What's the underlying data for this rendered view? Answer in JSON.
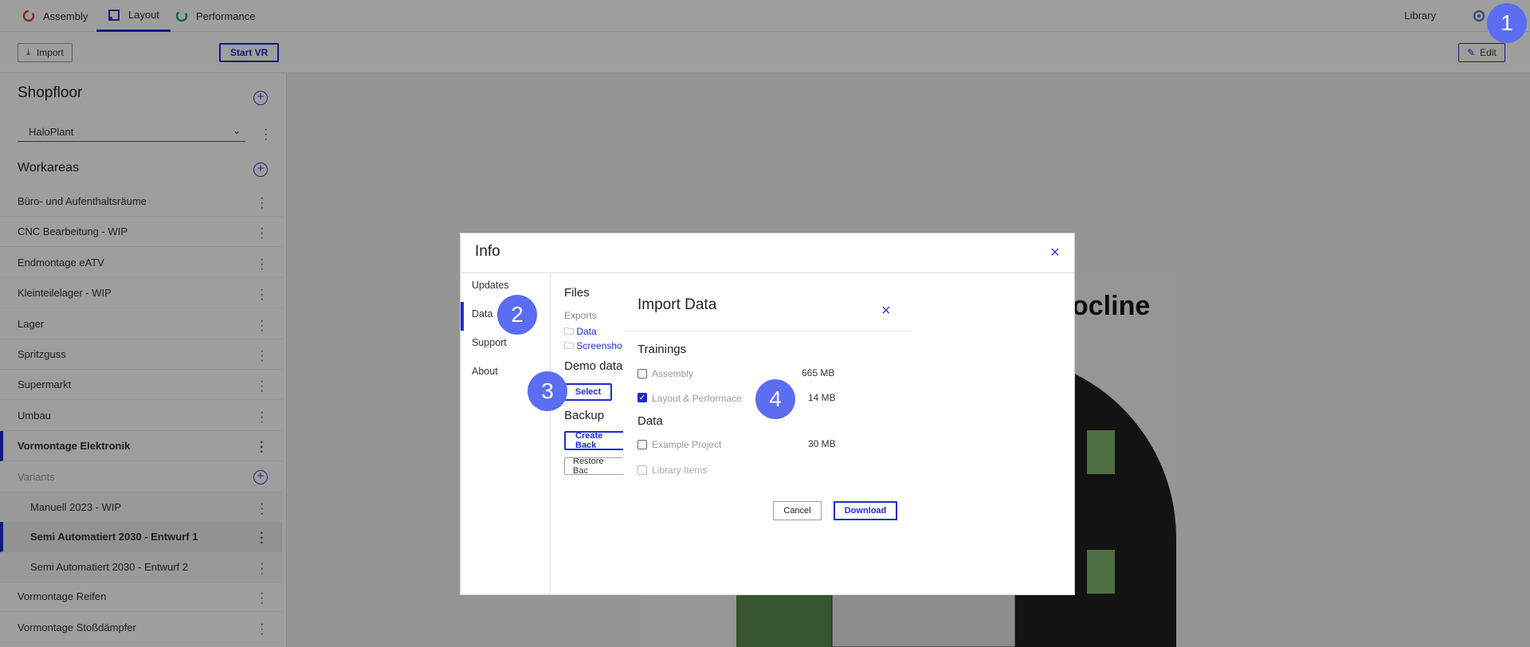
{
  "nav": {
    "tabs": [
      {
        "label": "Assembly",
        "icon": "assembly-icon",
        "color": "#e0443a"
      },
      {
        "label": "Layout",
        "icon": "layout-icon",
        "color": "#2a2fb5"
      },
      {
        "label": "Performance",
        "icon": "performance-icon",
        "color": "#2aa060"
      }
    ],
    "library": "Library"
  },
  "toolbar": {
    "import": "Import",
    "start_vr": "Start VR",
    "edit": "Edit"
  },
  "sidebar": {
    "shopfloor_title": "Shopfloor",
    "shopfloor_selected": "HaloPlant",
    "workareas_title": "Workareas",
    "items": [
      "Büro- und Aufenthaltsräume",
      "CNC Bearbeitung - WIP",
      "Endmontage eATV",
      "Kleinteilelager - WIP",
      "Lager",
      "Spritzguss",
      "Supermarkt",
      "Umbau",
      "Vormontage Elektronik"
    ],
    "variants_label": "Variants",
    "variants": [
      "Manuell 2023 - WIP",
      "Semi Automatiert 2030 - Entwurf 1",
      "Semi Automatiert 2030 - Entwurf 2"
    ],
    "more_items": [
      "Vormontage Reifen",
      "Vormontage Stoßdämpfer"
    ]
  },
  "canvas": {
    "brand_text": "ocline"
  },
  "info_dialog": {
    "title": "Info",
    "nav": [
      "Updates",
      "Data",
      "Support",
      "About"
    ],
    "files_title": "Files",
    "exports_label": "Exports",
    "folder_data": "Data",
    "folder_screenshots": "Screensho",
    "demo_title": "Demo data",
    "select_btn": "Select",
    "backup_title": "Backup",
    "create_backup": "Create Back",
    "restore_backup": "Restore Bac"
  },
  "import_dialog": {
    "title": "Import Data",
    "trainings_title": "Trainings",
    "trainings": [
      {
        "label": "Assembly",
        "size": "665 MB",
        "checked": false
      },
      {
        "label": "Layout & Performace",
        "size": "14 MB",
        "checked": true
      }
    ],
    "data_title": "Data",
    "data_items": [
      {
        "label": "Example Project",
        "size": "30 MB",
        "checked": false
      },
      {
        "label": "Library Items",
        "size": "",
        "checked": false
      }
    ],
    "cancel": "Cancel",
    "download": "Download"
  },
  "badges": [
    "1",
    "2",
    "3",
    "4"
  ]
}
